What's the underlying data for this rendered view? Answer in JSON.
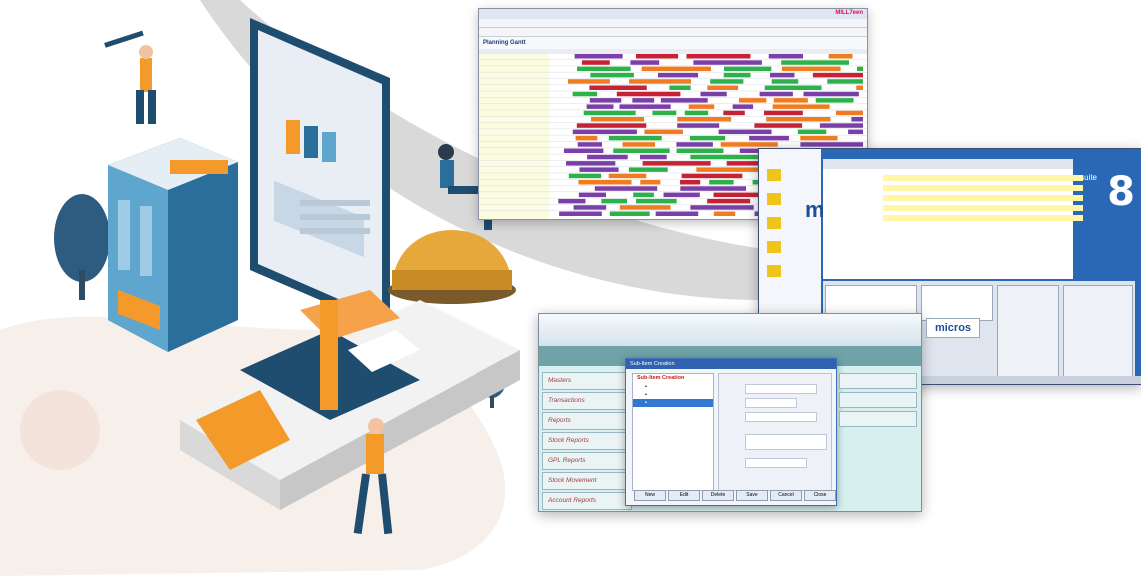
{
  "window_planning": {
    "brand": "MILL7een",
    "header": "Planning Gantt"
  },
  "window_suite8": {
    "brand_word": "micros",
    "logo_word": "suite",
    "logo_number": "8",
    "bottom_brand": "micros"
  },
  "window_accounting": {
    "dialog_title": "Sub-Item Creation",
    "menu_items": [
      {
        "label": "Masters"
      },
      {
        "label": "Transactions"
      },
      {
        "label": "Reports"
      },
      {
        "label": "Stock Reports"
      },
      {
        "label": "GPL Reports"
      },
      {
        "label": "Stock Movement"
      },
      {
        "label": "Account Reports"
      }
    ],
    "tree_root": "Sub-Item Creation",
    "buttons": [
      "New",
      "Edit",
      "Delete",
      "Save",
      "Cancel",
      "Close"
    ]
  },
  "colors": {
    "swoosh": "#d9d9d9",
    "bar_purple": "#7b3fa8",
    "bar_green": "#2fb14a",
    "bar_orange": "#f07c22",
    "bar_red": "#c62233",
    "suite_blue": "#2a67b5",
    "illus_blue": "#1f4d70",
    "illus_orange": "#f39a2b"
  }
}
